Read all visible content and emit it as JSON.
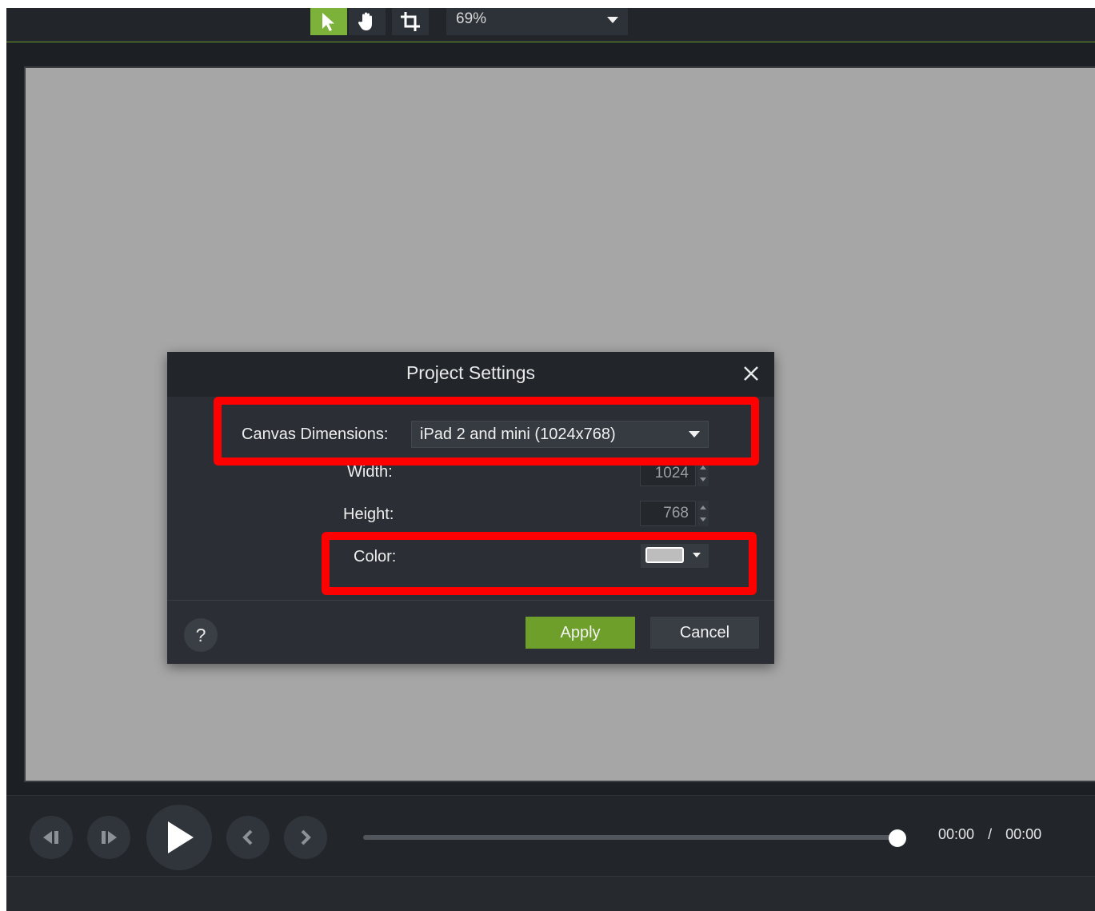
{
  "toolbar": {
    "tools": [
      "select-tool",
      "hand-tool",
      "crop-tool"
    ],
    "zoom_value": "69%"
  },
  "dialog": {
    "title": "Project Settings",
    "canvas_dimensions_label": "Canvas Dimensions:",
    "canvas_dimensions_value": "iPad 2 and mini (1024x768)",
    "width_label": "Width:",
    "width_value": "1024",
    "height_label": "Height:",
    "height_value": "768",
    "color_label": "Color:",
    "color_value": "#bdbdbd",
    "help_label": "?",
    "apply_label": "Apply",
    "cancel_label": "Cancel"
  },
  "playback": {
    "current_time": "00:00",
    "separator": "/",
    "total_time": "00:00",
    "scrub_position": 1.0
  },
  "colors": {
    "accent_green": "#7cb13a",
    "canvas_gray": "#a6a6a6",
    "annotation_red": "#ff0000"
  }
}
